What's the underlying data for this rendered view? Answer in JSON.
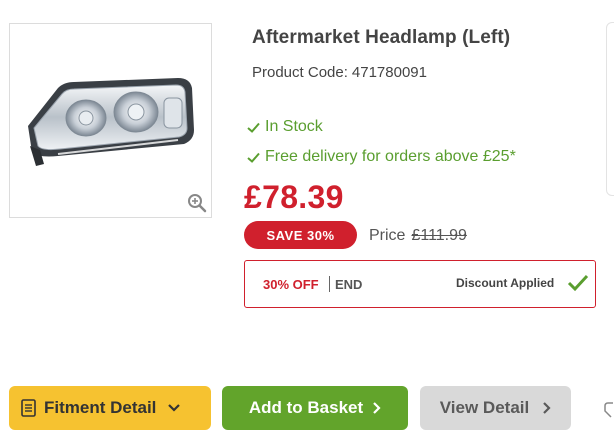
{
  "product": {
    "title": "Aftermarket Headlamp (Left)",
    "code_label": "Product Code:",
    "code_value": "471780091"
  },
  "features": [
    {
      "icon": "check-icon",
      "text": "In Stock"
    },
    {
      "icon": "check-icon",
      "text": "Free delivery for orders above £25*"
    }
  ],
  "pricing": {
    "current_price": "£78.39",
    "save_badge": "SAVE  30%",
    "price_label": "Price",
    "old_price": "£111.99"
  },
  "discount": {
    "off_text": "30% OFF",
    "end_text": "END",
    "applied_text": "Discount Applied"
  },
  "buttons": {
    "fitment": "Fitment Detail",
    "basket": "Add to Basket",
    "view": "View Detail"
  },
  "colors": {
    "brand_red": "#d0202d",
    "stock_green": "#5a9e2f",
    "basket_green": "#62a42b",
    "fitment_yellow": "#f6c230",
    "view_grey": "#d9d9d9"
  },
  "icons": {
    "zoom": "zoom-in-icon",
    "fitment": "document-icon",
    "chevron": "chevron-icon",
    "applied": "check-icon"
  }
}
